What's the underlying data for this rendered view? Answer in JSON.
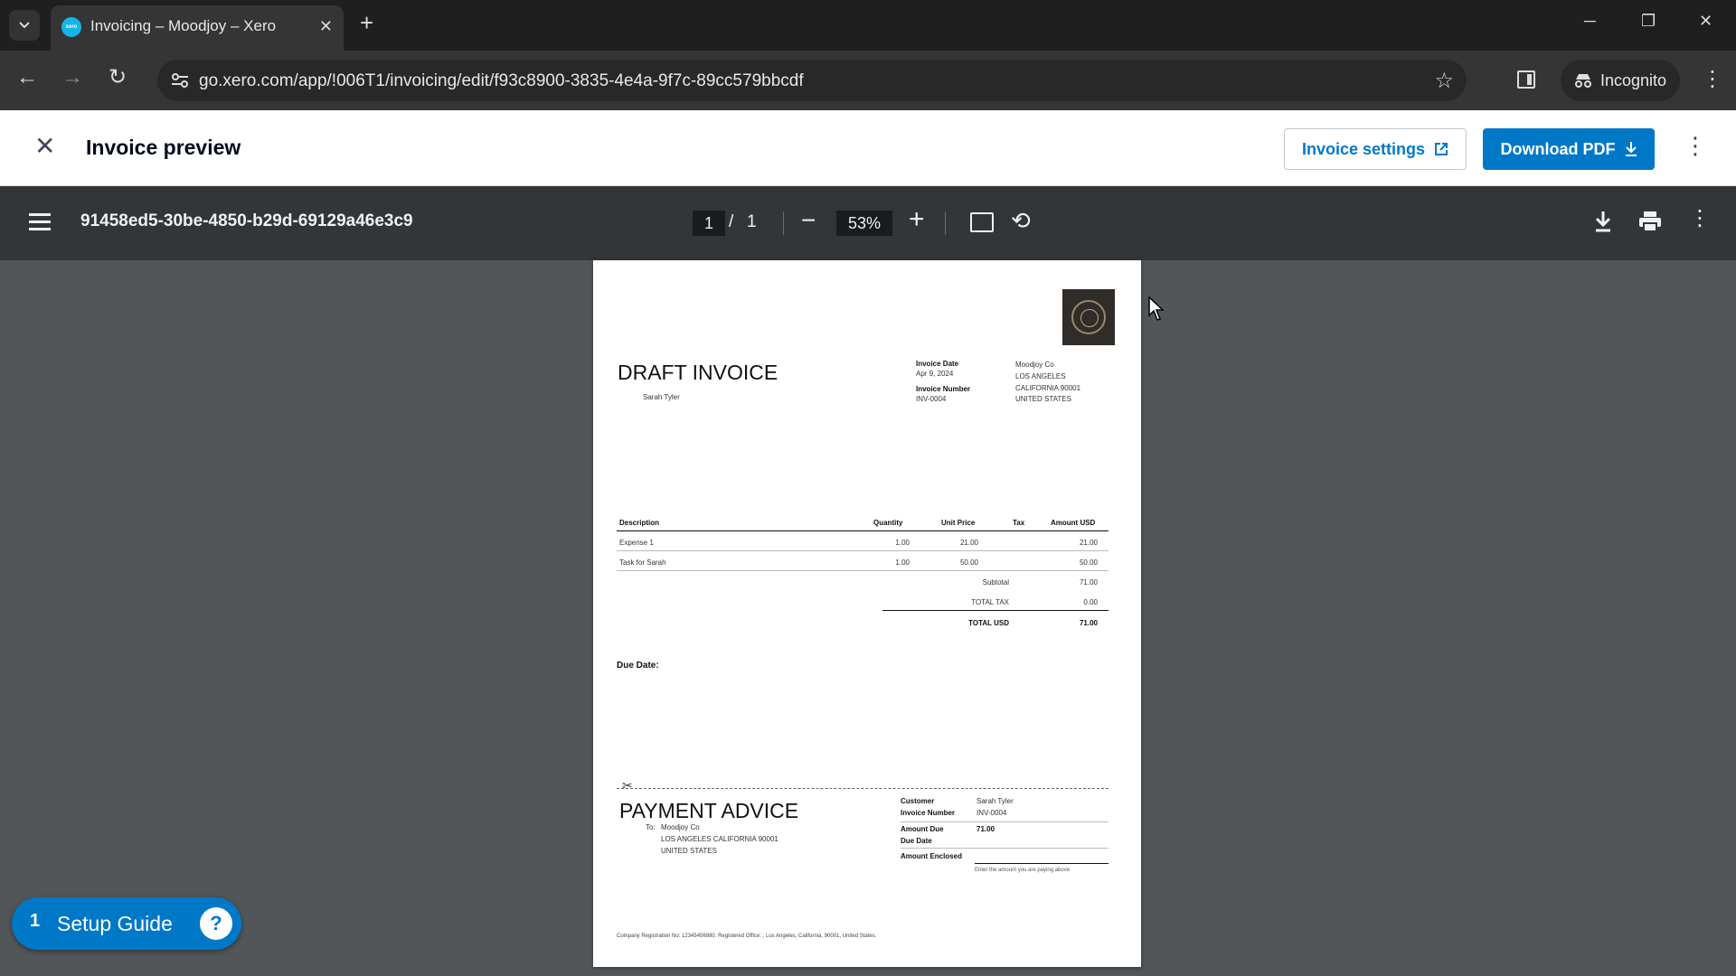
{
  "browser": {
    "tab_title": "Invoicing – Moodjoy – Xero",
    "favicon_text": "xero",
    "url": "go.xero.com/app/!006T1/invoicing/edit/f93c8900-3835-4e4a-9f7c-89cc579bbcdf",
    "profile_label": "Incognito"
  },
  "header": {
    "title": "Invoice preview",
    "settings_label": "Invoice settings",
    "download_label": "Download PDF"
  },
  "pdf_toolbar": {
    "filename": "91458ed5-30be-4850-b29d-69129a46e3c9",
    "current_page": "1",
    "separator": "/",
    "total_pages": "1",
    "zoom": "53%"
  },
  "invoice": {
    "title": "DRAFT INVOICE",
    "to_name": "Sarah Tyler",
    "date_label": "Invoice Date",
    "date_value": "Apr 9, 2024",
    "number_label": "Invoice Number",
    "number_value": "INV-0004",
    "from_address": [
      "Moodjoy Co",
      "LOS ANGELES",
      "CALIFORNIA 90001",
      "UNITED STATES"
    ],
    "columns": [
      "Description",
      "Quantity",
      "Unit Price",
      "Tax",
      "Amount USD"
    ],
    "rows": [
      {
        "description": "Expense 1",
        "quantity": "1.00",
        "unit_price": "21.00",
        "tax": "",
        "amount": "21.00"
      },
      {
        "description": "Task for Sarah",
        "quantity": "1.00",
        "unit_price": "50.00",
        "tax": "",
        "amount": "50.00"
      }
    ],
    "subtotal_label": "Subtotal",
    "subtotal_value": "71.00",
    "tax_label": "TOTAL TAX",
    "tax_value": "0.00",
    "total_label": "TOTAL USD",
    "total_value": "71.00",
    "due_label": "Due Date:"
  },
  "payment_advice": {
    "title": "PAYMENT ADVICE",
    "to_label": "To:",
    "to_lines": [
      "Moodjoy Co",
      "LOS ANGELES CALIFORNIA 90001",
      "UNITED STATES"
    ],
    "customer_label": "Customer",
    "customer_value": "Sarah Tyler",
    "number_label": "Invoice Number",
    "number_value": "INV-0004",
    "amount_due_label": "Amount Due",
    "amount_due_value": "71.00",
    "due_date_label": "Due Date",
    "enclosed_label": "Amount Enclosed",
    "enclosed_note": "Enter the amount you are paying above",
    "footer": "Company Registration No: 12345456880.  Registered Office: , Los Angeles, California, 90001, United States."
  },
  "setup_guide": {
    "count": "1",
    "label": "Setup Guide",
    "help_icon": "question-icon"
  },
  "colors": {
    "xero_blue": "#0078c8",
    "viewer_bg": "#525659",
    "viewer_toolbar": "#323639"
  }
}
